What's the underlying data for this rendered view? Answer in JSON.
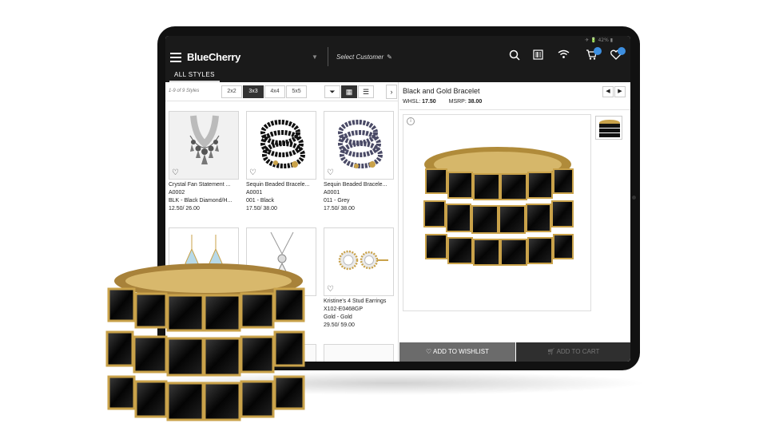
{
  "status": {
    "text": "✈ 🔋 42% ▮"
  },
  "header": {
    "brand": "BlueCherry",
    "brand_caret": "▼",
    "customer": "Select Customer",
    "customer_icon": "✎",
    "icons": [
      "search-icon",
      "barcode-icon",
      "wifi-icon",
      "cart-icon",
      "wishlist-icon"
    ],
    "tab": "ALL STYLES"
  },
  "toolbar": {
    "count": "1-9 of 9 Styles",
    "grid_options": [
      "2x2",
      "3x3",
      "4x4",
      "5x5"
    ],
    "selected_grid": "3x3",
    "filter_glyph": "⏷",
    "grid_glyph": "▦",
    "list_glyph": "☰",
    "expand_glyph": "›"
  },
  "products": [
    {
      "name": "Crystal Fan Statement ...",
      "style": "A0002",
      "color": "BLK - Black Diamond/H...",
      "price": "12.50/ 26.00"
    },
    {
      "name": "Sequin Beaded Bracele...",
      "style": "A0001",
      "color": "001 - Black",
      "price": "17.50/ 38.00"
    },
    {
      "name": "Sequin Beaded Bracele...",
      "style": "A0001",
      "color": "011 - Grey",
      "price": "17.50/ 38.00"
    },
    {
      "name": "",
      "style": "",
      "color": "",
      "price": ""
    },
    {
      "name": "",
      "style": "",
      "color": "",
      "price": ""
    },
    {
      "name": "Kristine's 4 Stud Earrings",
      "style": "X102-E0468GP",
      "color": "Gold - Gold",
      "price": "29.50/ 59.00"
    }
  ],
  "detail": {
    "name": "Black and Gold Bracelet",
    "whsl_label": "WHSL:",
    "whsl": "17.50",
    "msrp_label": "MSRP:",
    "msrp": "38.00",
    "info": "i",
    "prev": "◀",
    "next": "▶"
  },
  "actions": {
    "wishlist": "ADD TO WISHLIST",
    "cart": "ADD TO CART"
  },
  "colors": {
    "topbar": "#1a1a1a",
    "badge": "#3d8fe0",
    "wishlist_btn": "#6b6b6b",
    "cart_btn": "#2f2f2f"
  }
}
